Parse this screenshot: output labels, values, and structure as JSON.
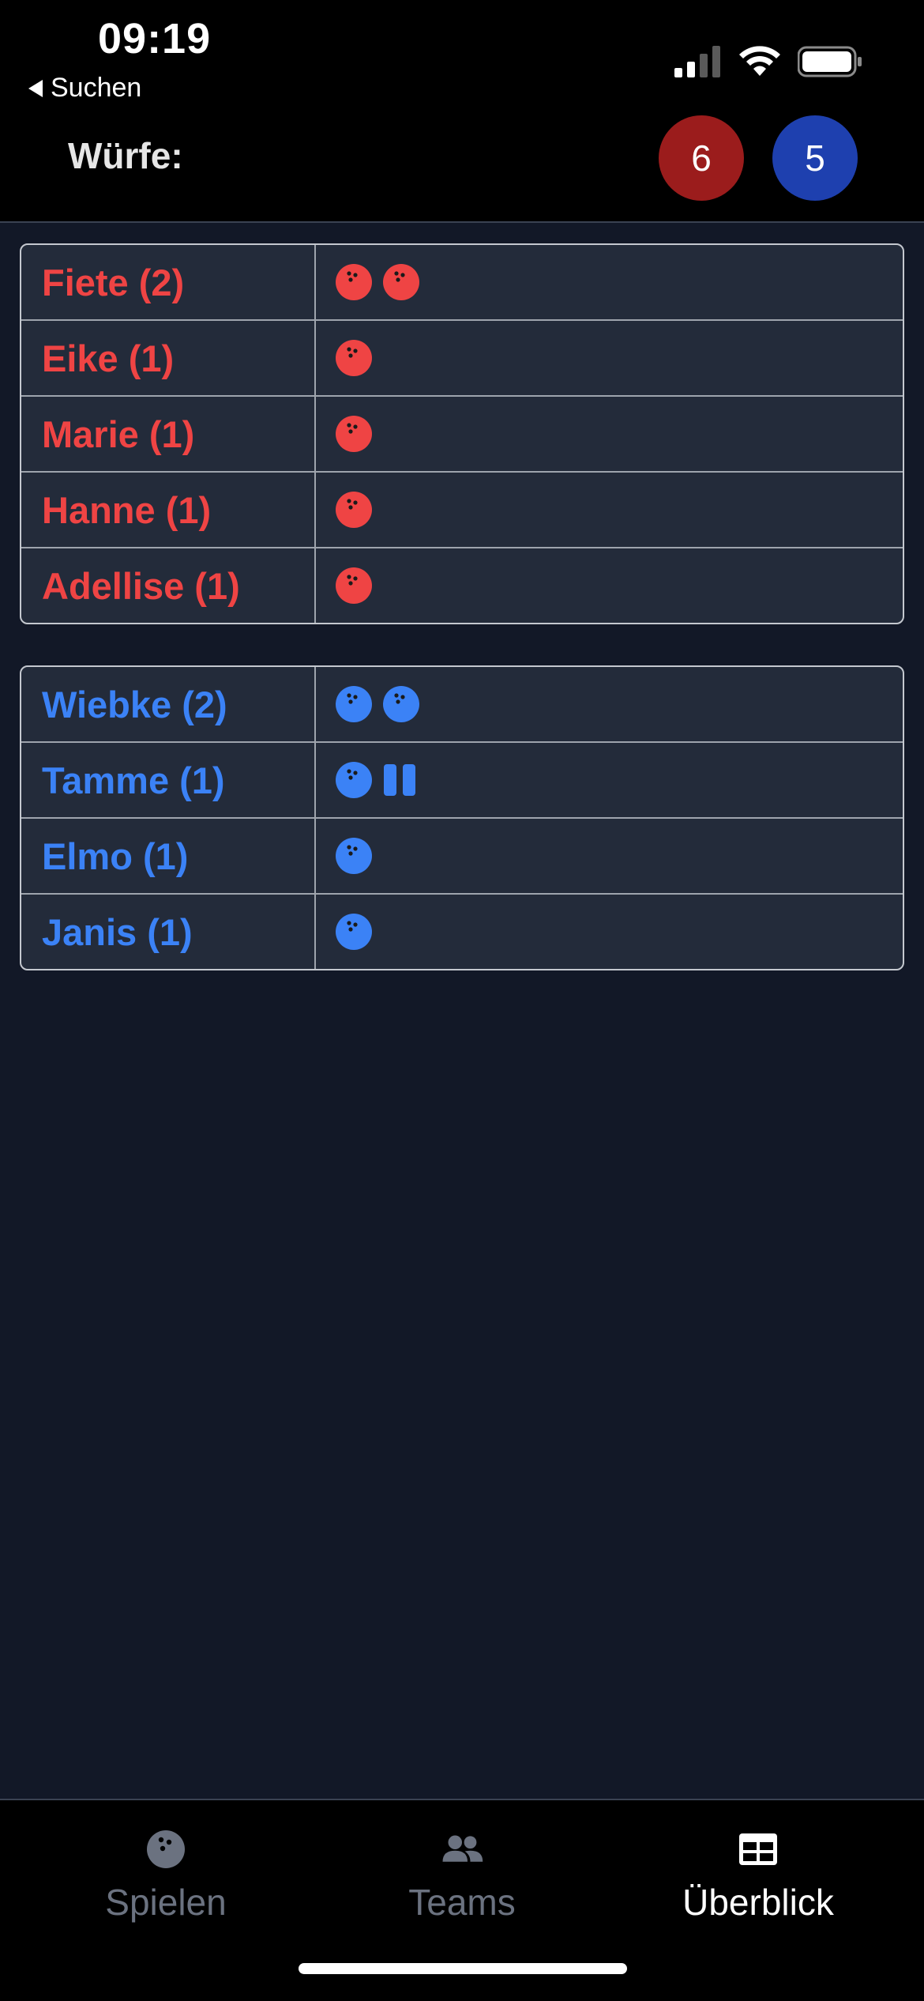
{
  "status_bar": {
    "time": "09:19",
    "back_label": "Suchen"
  },
  "header": {
    "label": "Würfe:",
    "score_red": "6",
    "score_blue": "5"
  },
  "colors": {
    "red_team": "#ef4444",
    "blue_team": "#3b82f6",
    "red_badge": "#9b1c1c",
    "blue_badge": "#1e40af"
  },
  "red_team": [
    {
      "name": "Fiete (2)",
      "throws": [
        "ball",
        "ball"
      ]
    },
    {
      "name": "Eike (1)",
      "throws": [
        "ball"
      ]
    },
    {
      "name": "Marie (1)",
      "throws": [
        "ball"
      ]
    },
    {
      "name": "Hanne (1)",
      "throws": [
        "ball"
      ]
    },
    {
      "name": "Adellise (1)",
      "throws": [
        "ball"
      ]
    }
  ],
  "blue_team": [
    {
      "name": "Wiebke (2)",
      "throws": [
        "ball",
        "ball"
      ]
    },
    {
      "name": "Tamme (1)",
      "throws": [
        "ball",
        "pause"
      ]
    },
    {
      "name": "Elmo (1)",
      "throws": [
        "ball"
      ]
    },
    {
      "name": "Janis (1)",
      "throws": [
        "ball"
      ]
    }
  ],
  "tabs": [
    {
      "label": "Spielen",
      "icon": "bowling-ball-icon",
      "active": false
    },
    {
      "label": "Teams",
      "icon": "users-icon",
      "active": false
    },
    {
      "label": "Überblick",
      "icon": "table-icon",
      "active": true
    }
  ]
}
